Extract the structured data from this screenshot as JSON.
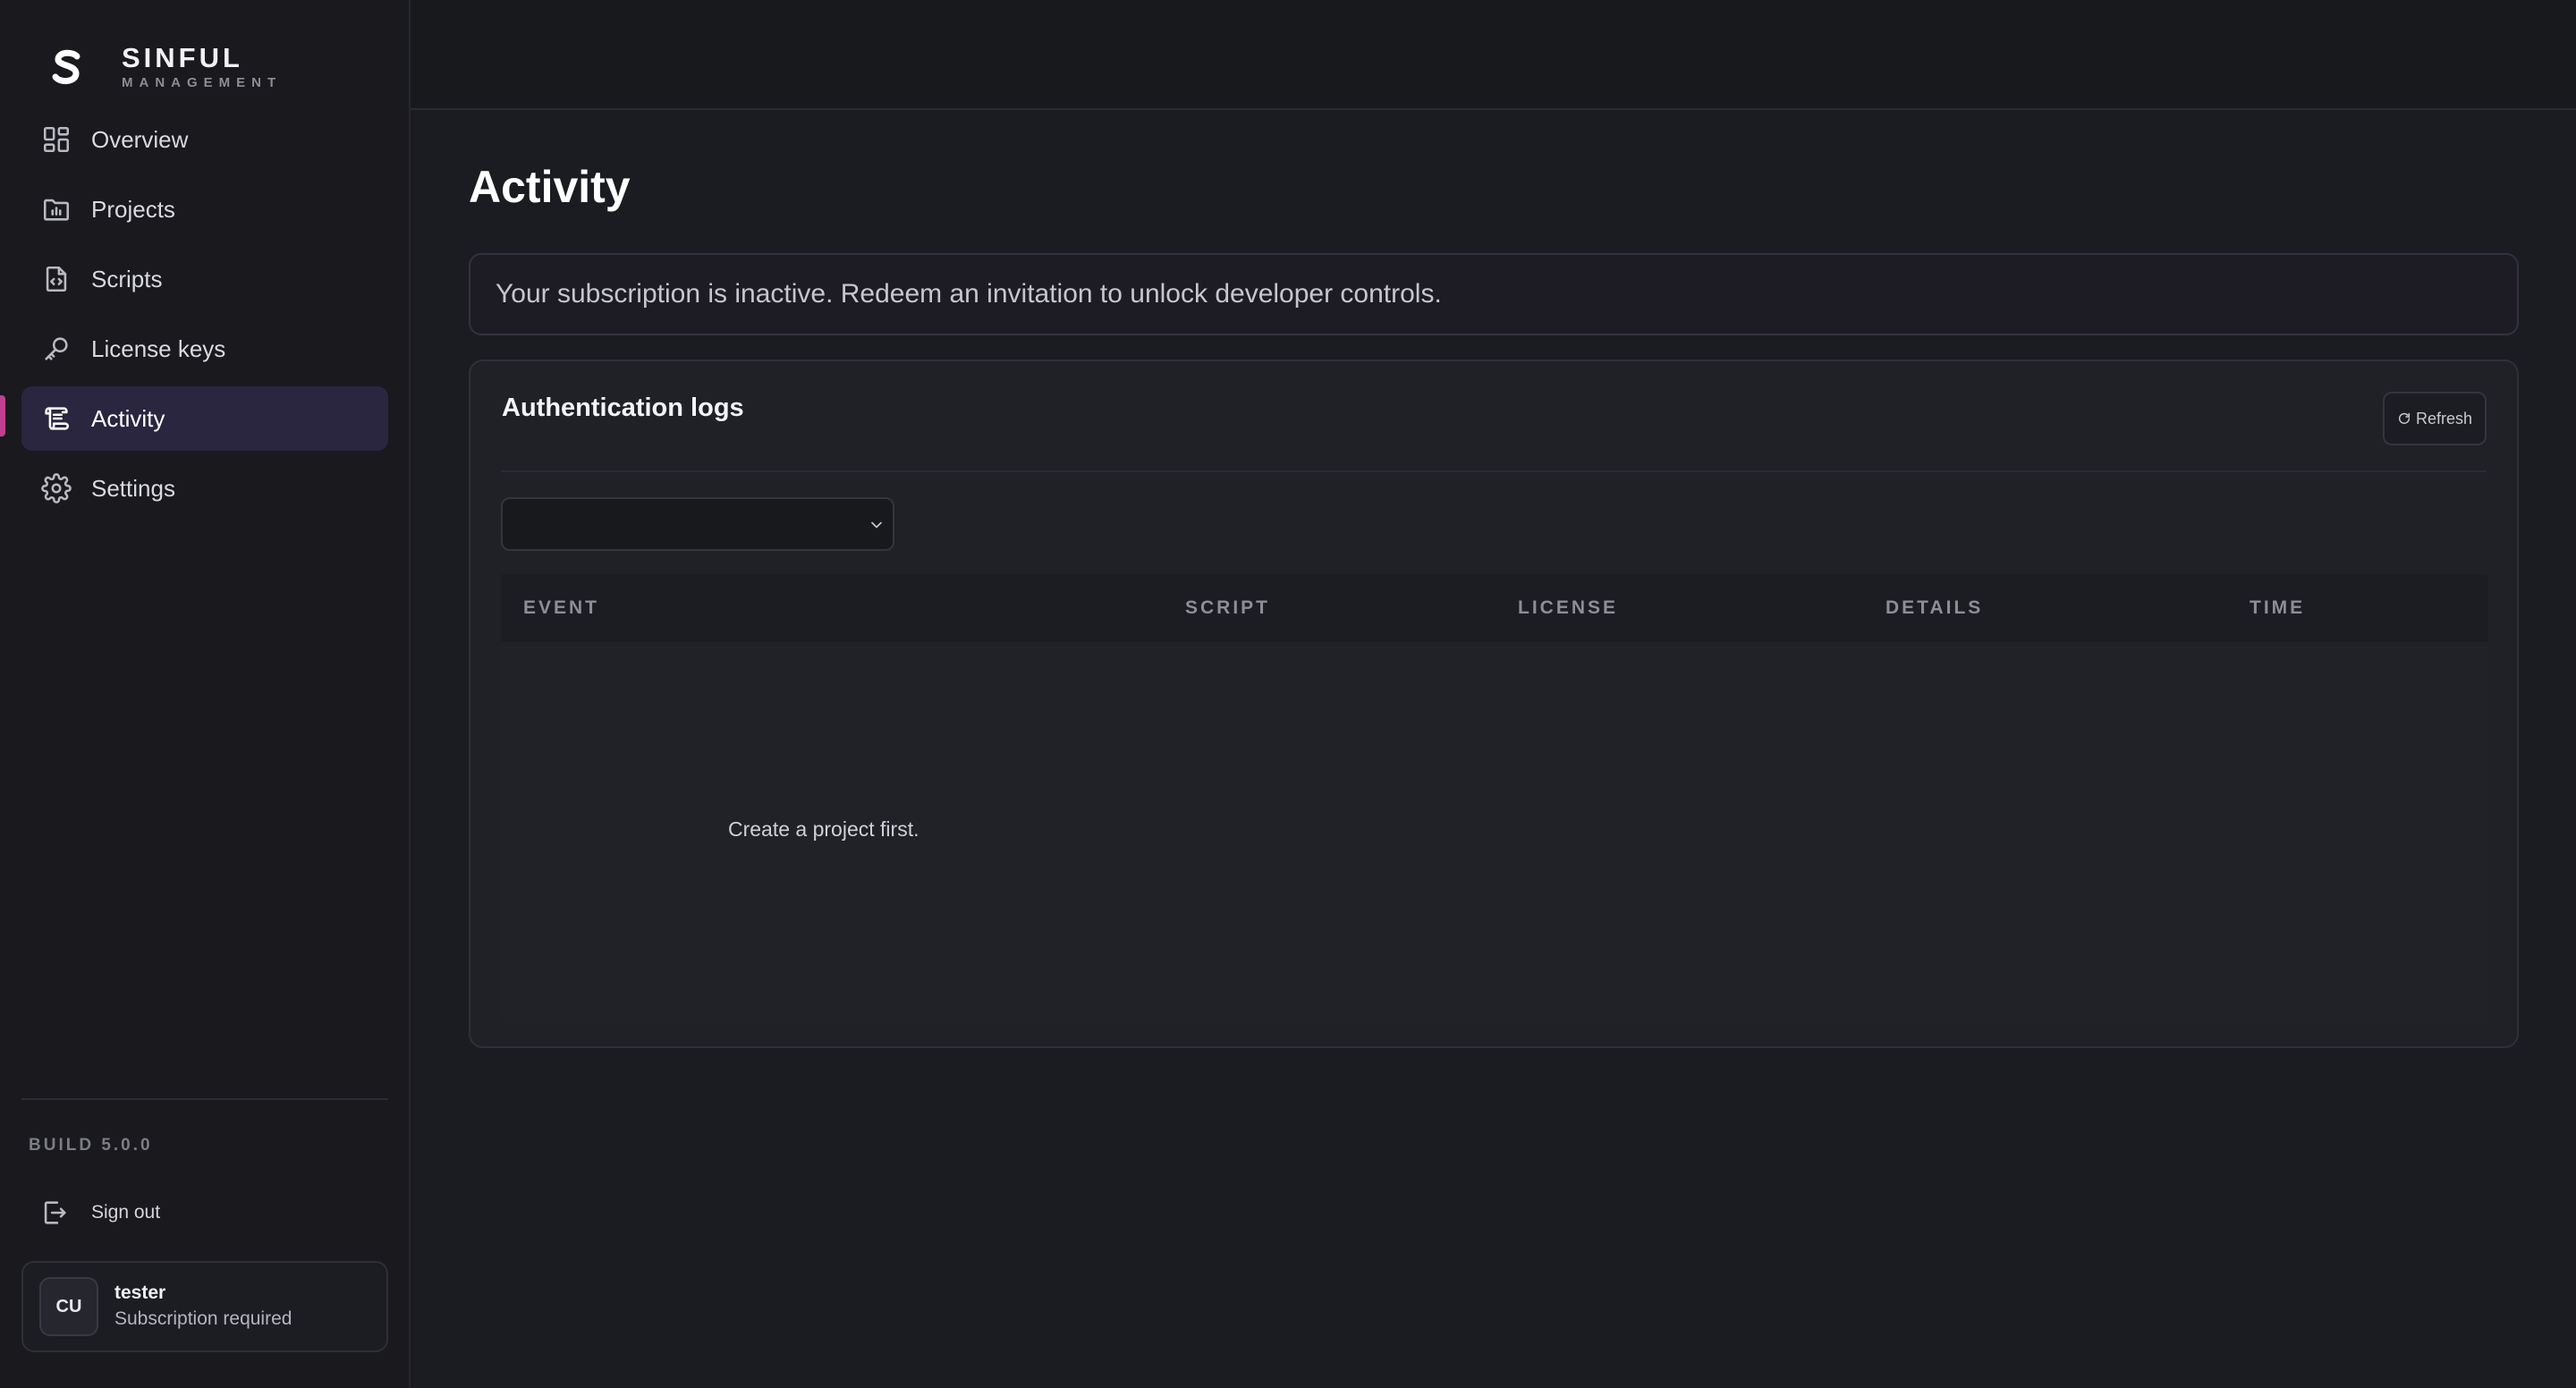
{
  "brand": {
    "name": "SINFUL",
    "subtitle": "MANAGEMENT"
  },
  "nav": [
    {
      "label": "Overview",
      "icon": "grid-icon",
      "active": false
    },
    {
      "label": "Projects",
      "icon": "folder-icon",
      "active": false
    },
    {
      "label": "Scripts",
      "icon": "file-code-icon",
      "active": false
    },
    {
      "label": "License keys",
      "icon": "key-icon",
      "active": false
    },
    {
      "label": "Activity",
      "icon": "scroll-icon",
      "active": true
    },
    {
      "label": "Settings",
      "icon": "gear-icon",
      "active": false
    }
  ],
  "sidebar_footer": {
    "build": "BUILD 5.0.0",
    "signout_label": "Sign out"
  },
  "user": {
    "initials": "CU",
    "name": "tester",
    "status": "Subscription required"
  },
  "page": {
    "title": "Activity",
    "alert": "Your subscription is inactive. Redeem an invitation to unlock developer controls."
  },
  "logs": {
    "title": "Authentication logs",
    "refresh_label": "Refresh",
    "project_select_value": "",
    "columns": [
      "EVENT",
      "SCRIPT",
      "LICENSE",
      "DETAILS",
      "TIME"
    ],
    "rows": [],
    "empty_message": "Create a project first."
  },
  "colors": {
    "accent": "#c0408f",
    "active_nav_bg": "#2a2640",
    "background": "#1b1c21"
  }
}
